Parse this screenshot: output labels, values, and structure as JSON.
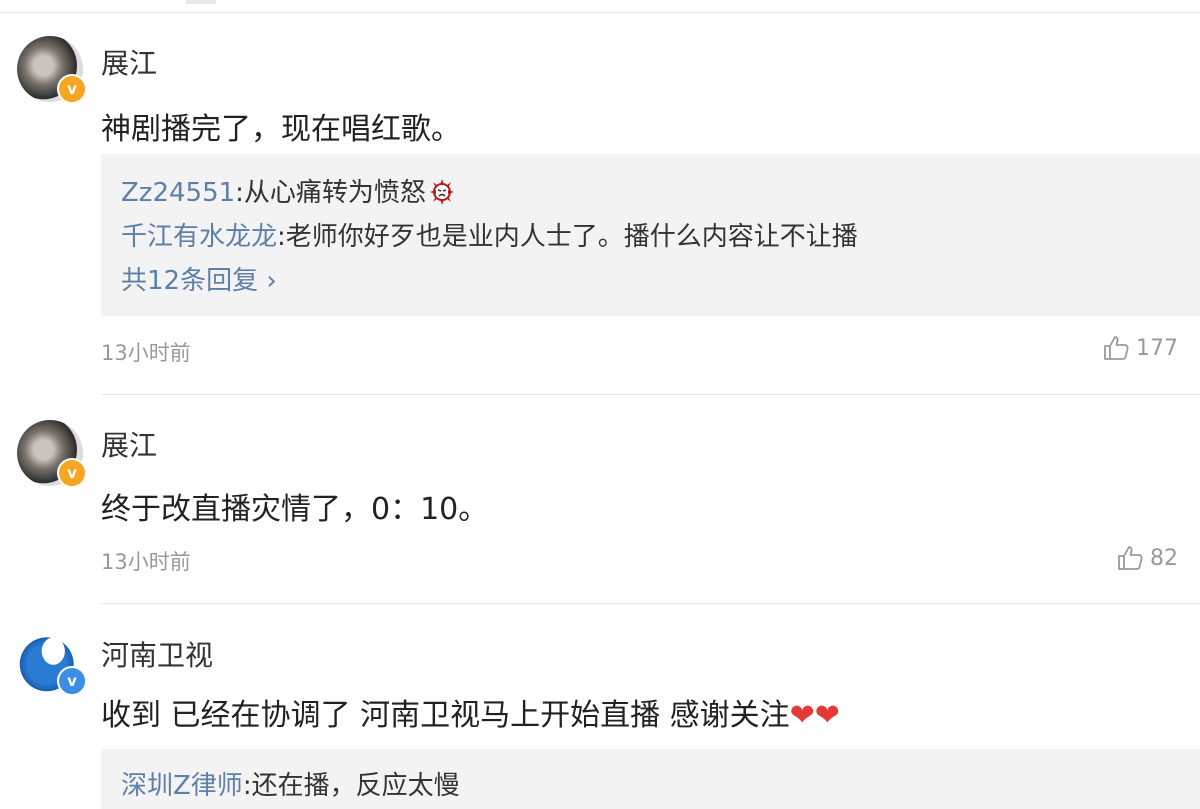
{
  "comments": [
    {
      "author": "展江",
      "text": "神剧播完了，现在唱红歌。",
      "replies": [
        {
          "user": "Zz24551",
          "text": ":从心痛转为愤怒",
          "icon": "angry-emoji-icon"
        },
        {
          "user": "千江有水龙龙",
          "text": ":老师你好歹也是业内人士了。播什么内容让不让播"
        }
      ],
      "more": "共12条回复 ›",
      "time": "13小时前",
      "likes": "177",
      "badge_color": "#f5a623"
    },
    {
      "author": "展江",
      "text": "终于改直播灾情了，0：10。",
      "time": "13小时前",
      "likes": "82",
      "badge_color": "#f5a623"
    },
    {
      "author": "河南卫视",
      "text": "收到 已经在协调了 河南卫视马上开始直播 感谢关注",
      "hearts": "❤❤",
      "replies": [
        {
          "user": "深圳Z律师",
          "text": ":还在播，反应太慢"
        }
      ],
      "badge_color": "#3a8ee6"
    }
  ],
  "badge_glyph": "v",
  "colors": {
    "link": "#5d7fa8",
    "muted": "#999999",
    "reply_bg": "#f3f3f3"
  }
}
